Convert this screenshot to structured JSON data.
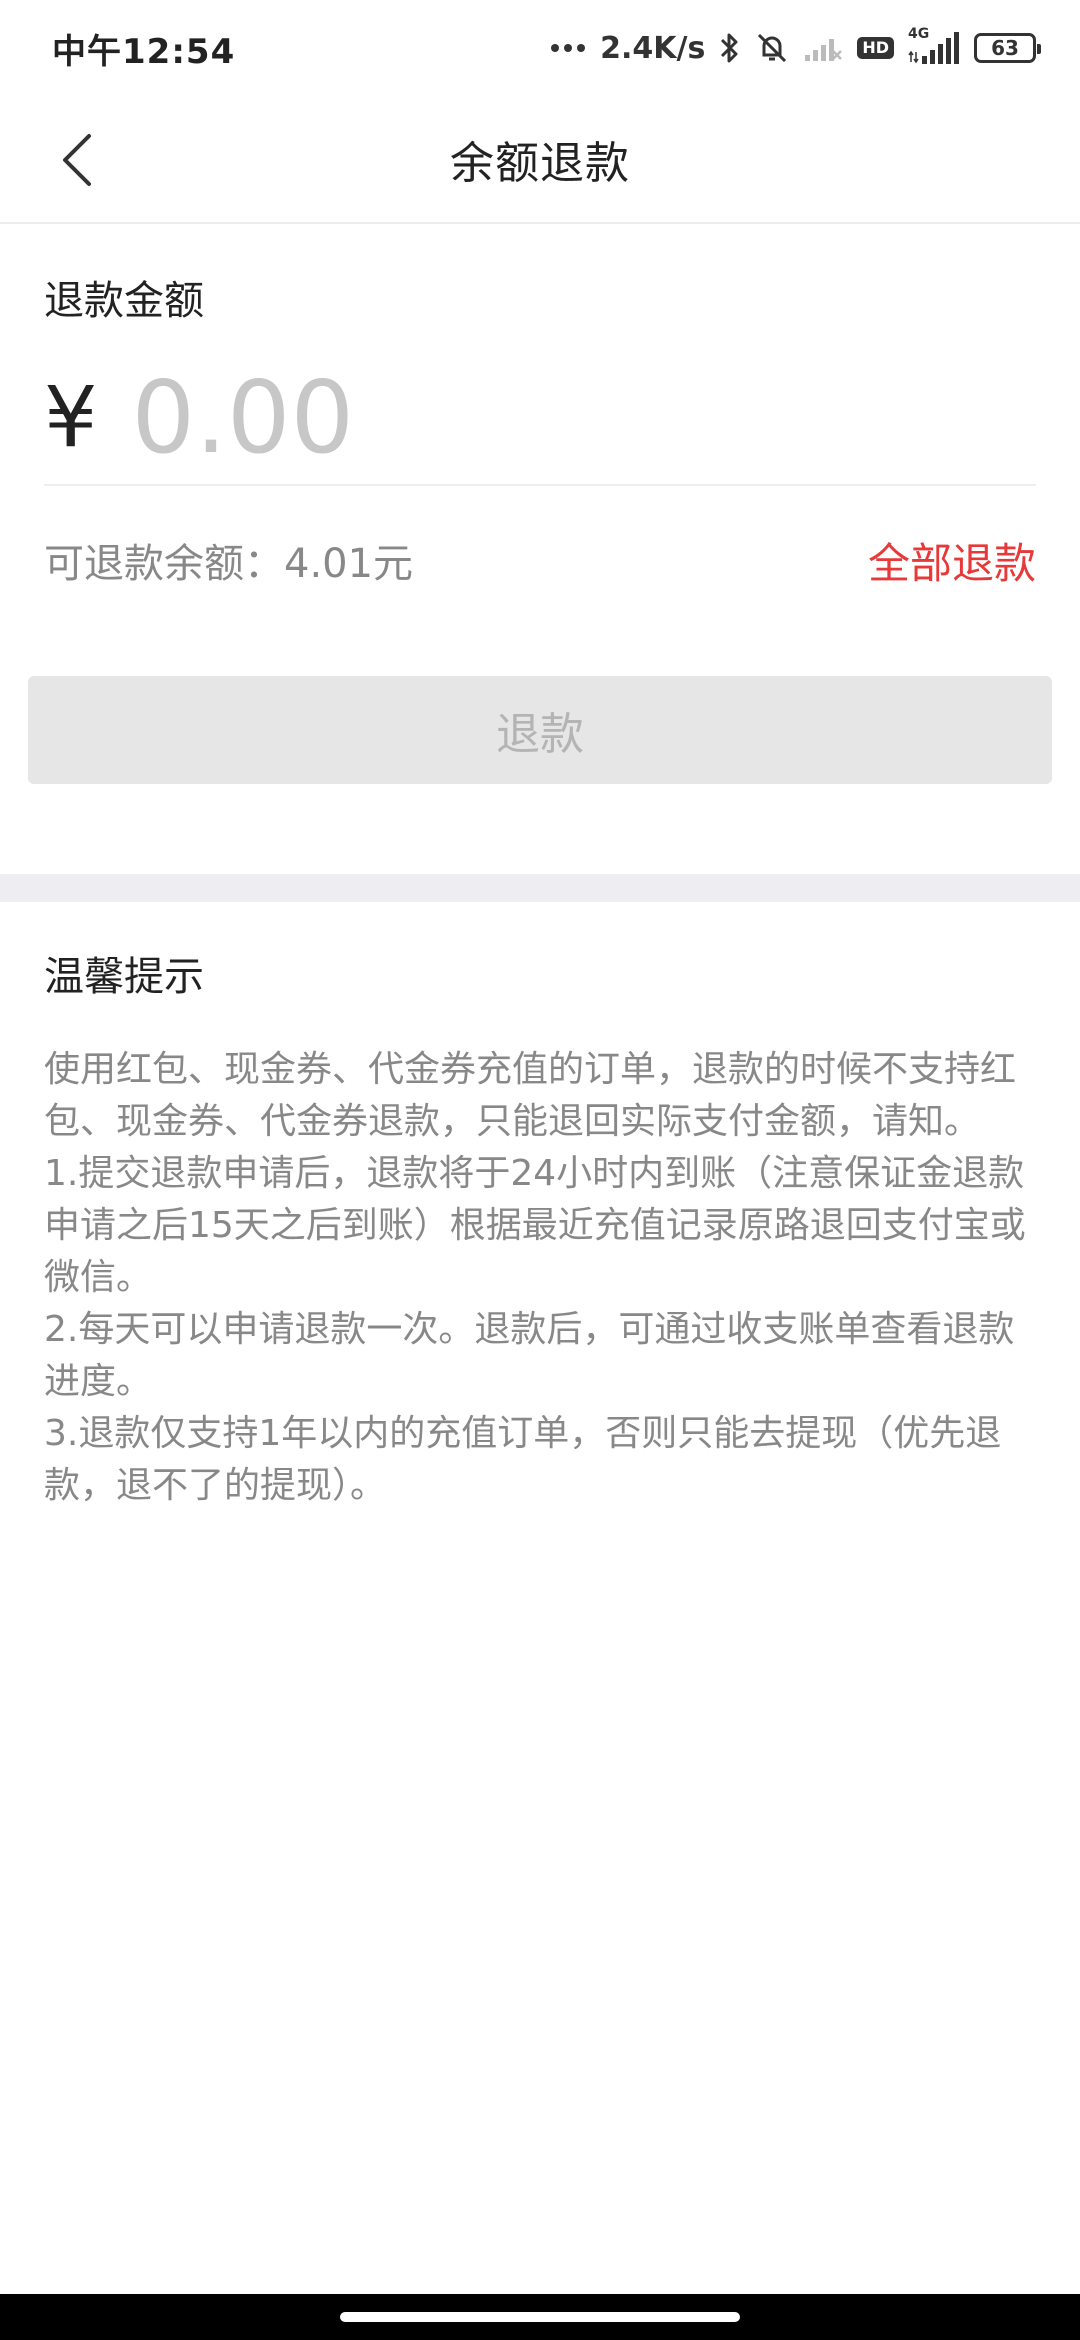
{
  "status_bar": {
    "time": "中午12:54",
    "network_speed": "2.4K/s",
    "signal_label": "4G",
    "hd_label": "HD",
    "battery": "63",
    "icons": [
      "more-dots-icon",
      "bluetooth-icon",
      "mute-bell-icon",
      "signal-weak-icon",
      "hd-icon",
      "signal-4g-icon",
      "battery-icon"
    ]
  },
  "header": {
    "title": "余额退款",
    "back_icon": "back-chevron-icon"
  },
  "amount": {
    "label": "退款金额",
    "currency_symbol": "¥",
    "placeholder": "0.00",
    "value": ""
  },
  "available": {
    "text": "可退款余额：4.01元",
    "refund_all_label": "全部退款"
  },
  "refund_button": {
    "label": "退款"
  },
  "tips": {
    "title": "温馨提示",
    "paragraphs": [
      "使用红包、现金券、代金券充值的订单，退款的时候不支持红包、现金券、代金券退款，只能退回实际支付金额，请知。",
      "1.提交退款申请后，退款将于24小时内到账（注意保证金退款申请之后15天之后到账）根据最近充值记录原路退回支付宝或微信。",
      "2.每天可以申请退款一次。退款后，可通过收支账单查看退款进度。",
      "3.退款仅支持1年以内的充值订单，否则只能去提现（优先退款，退不了的提现）。"
    ]
  },
  "colors": {
    "accent_red": "#e8393a",
    "disabled_button_bg": "#e6e6e6",
    "disabled_button_text": "#b4b4b4",
    "muted_text": "#888888",
    "divider_band": "#ededf2"
  }
}
